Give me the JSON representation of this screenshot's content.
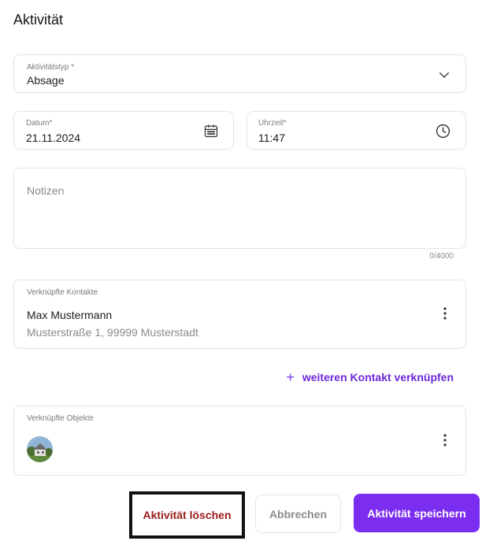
{
  "page": {
    "title": "Aktivität"
  },
  "activity_type": {
    "label": "Aktivitätstyp",
    "required_mark": "*",
    "value": "Absage"
  },
  "date": {
    "label": "Datum*",
    "value": "21.11.2024"
  },
  "time": {
    "label": "Uhrzeit*",
    "value": "11:47"
  },
  "notes": {
    "placeholder": "Notizen",
    "counter": "0/4000"
  },
  "contacts": {
    "label": "Verknüpfte Kontakte",
    "items": [
      {
        "name": "Max Mustermann",
        "address": "Musterstraße 1, 99999 Musterstadt"
      }
    ],
    "add_label": "weiteren Kontakt verknüpfen",
    "add_icon": "+"
  },
  "objects": {
    "label": "Verknüpfte Objekte"
  },
  "actions": {
    "delete_label": "Aktivität löschen",
    "cancel_label": "Abbrechen",
    "save_label": "Aktivität speichern"
  },
  "colors": {
    "accent": "#7c2ef0",
    "danger": "#9b1c1c",
    "link": "#6d28d9"
  }
}
